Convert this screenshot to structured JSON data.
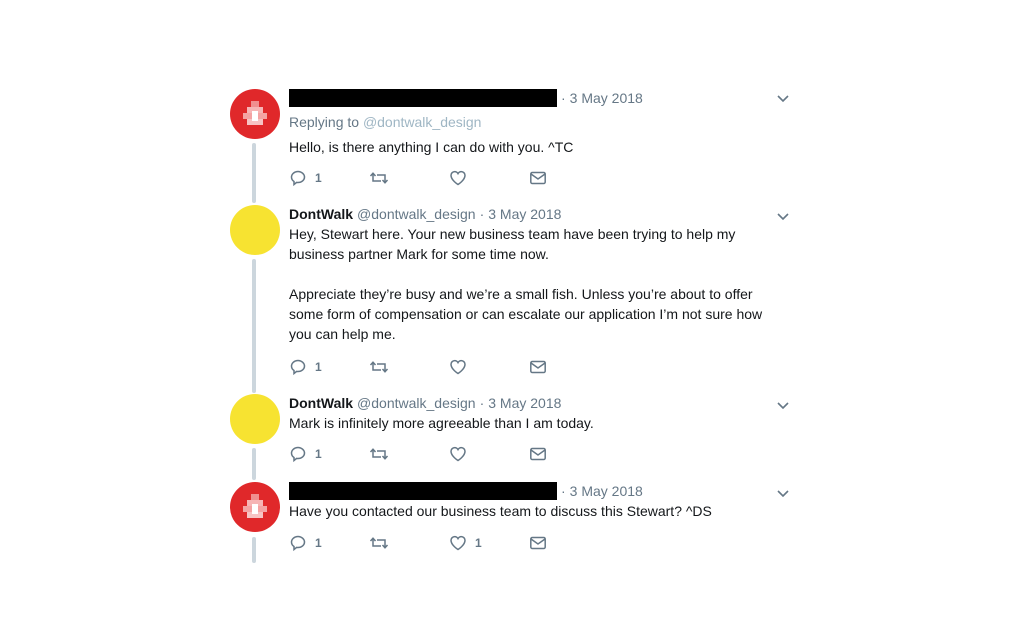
{
  "tweets": [
    {
      "author_redacted": true,
      "name": "",
      "handle": "",
      "date": "3 May 2018",
      "replying_label": "Replying to",
      "replying_to": "@dontwalk_design",
      "text": "Hello, is there anything I can do with you. ^TC",
      "reply_count": "1",
      "like_count": "",
      "avatar": "red-logo"
    },
    {
      "author_redacted": false,
      "name": "DontWalk",
      "handle": "@dontwalk_design",
      "date": "3 May 2018",
      "text": "Hey, Stewart here. Your new business team have been trying to help my\nbusiness partner Mark for some time now.\n\nAppreciate they’re busy and we’re a small fish. Unless you’re about to offer\nsome form of compensation or can escalate our application I’m not sure how\nyou can help me.",
      "reply_count": "1",
      "like_count": "",
      "avatar": "yellow-circle"
    },
    {
      "author_redacted": false,
      "name": "DontWalk",
      "handle": "@dontwalk_design",
      "date": "3 May 2018",
      "text": "Mark is infinitely more agreeable than I am today.",
      "reply_count": "1",
      "like_count": "",
      "avatar": "yellow-circle"
    },
    {
      "author_redacted": true,
      "name": "",
      "handle": "",
      "date": "3 May 2018",
      "text": "Have you contacted our business team to discuss this Stewart? ^DS",
      "reply_count": "1",
      "like_count": "1",
      "avatar": "red-logo"
    }
  ],
  "separator": "·",
  "icons": {
    "reply": "reply-icon",
    "retweet": "retweet-icon",
    "like": "heart-icon",
    "dm": "envelope-icon",
    "menu": "chevron-down-icon"
  },
  "colors": {
    "secondary_text": "#657786",
    "thread_line": "#ccd6dd",
    "red_avatar": "#e0282a",
    "yellow_avatar": "#f7e331"
  }
}
